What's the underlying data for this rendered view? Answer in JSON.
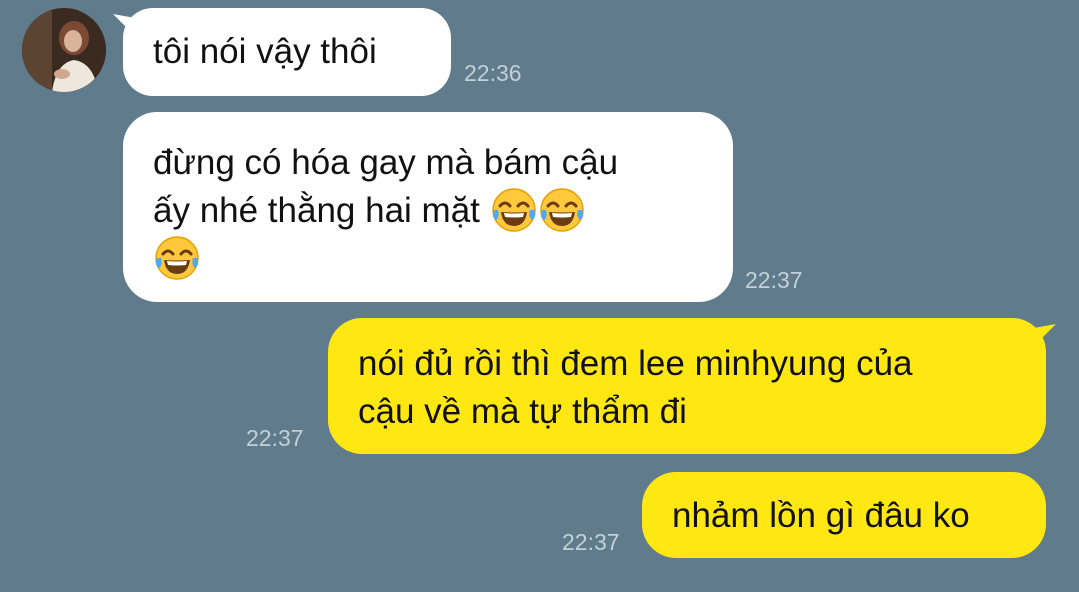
{
  "colors": {
    "background": "#607B8C",
    "incoming_bubble": "#ffffff",
    "outgoing_bubble": "#FFE812",
    "timestamp": "#C3D0D8"
  },
  "messages": [
    {
      "direction": "incoming",
      "lines": [
        "tôi nói vậy thôi"
      ],
      "time": "22:36"
    },
    {
      "direction": "incoming",
      "lines": [
        "đừng có hóa gay mà bám cậu",
        "ấy nhé thằng hai mặt"
      ],
      "emoji": "face-with-tears-of-joy",
      "time": "22:37"
    },
    {
      "direction": "outgoing",
      "lines": [
        "nói đủ rồi thì đem lee minhyung của",
        "cậu về mà tự thẩm đi"
      ],
      "time": "22:37"
    },
    {
      "direction": "outgoing",
      "lines": [
        "nhảm lồn gì đâu ko"
      ],
      "time": "22:37"
    }
  ]
}
